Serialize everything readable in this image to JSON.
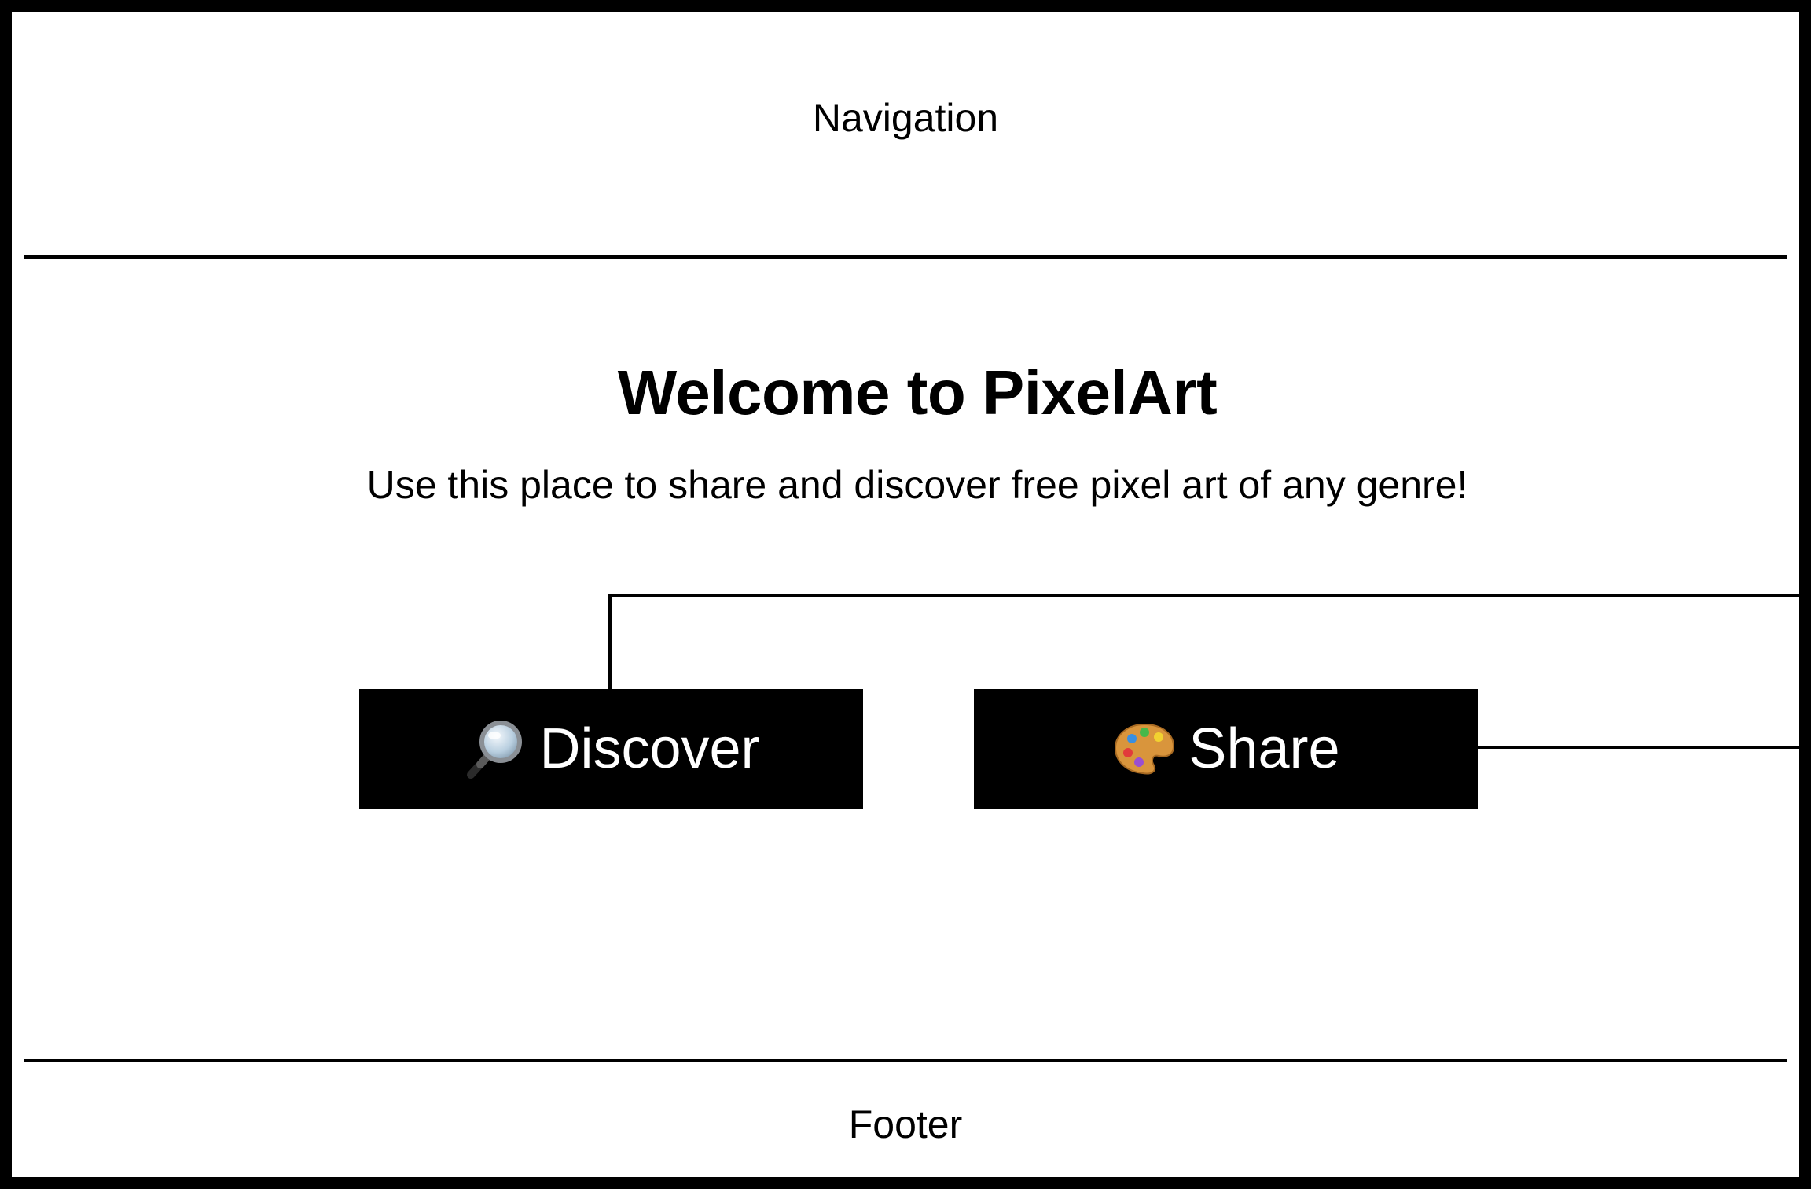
{
  "navigation": {
    "label": "Navigation"
  },
  "hero": {
    "title": "Welcome to PixelArt",
    "subtitle": "Use this place to share and discover free pixel art of any genre!"
  },
  "actions": {
    "discover": {
      "label": "Discover",
      "icon": "magnifying-glass-icon"
    },
    "share": {
      "label": "Share",
      "icon": "artist-palette-icon"
    }
  },
  "footer": {
    "label": "Footer"
  },
  "colors": {
    "border": "#000000",
    "button_bg": "#000000",
    "button_text": "#ffffff",
    "background": "#ffffff"
  }
}
